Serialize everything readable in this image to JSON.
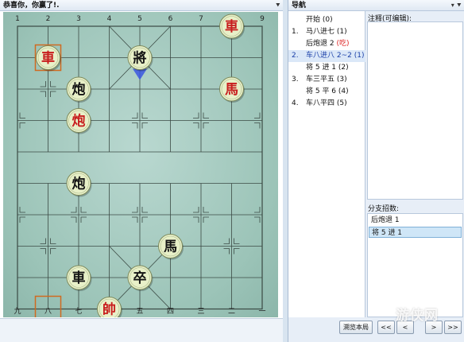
{
  "board_panel": {
    "title": "恭喜你，你赢了!."
  },
  "board": {
    "top_files": [
      "1",
      "2",
      "3",
      "4",
      "5",
      "6",
      "7",
      "8",
      "9"
    ],
    "bottom_files": [
      "九",
      "八",
      "七",
      "六",
      "五",
      "四",
      "三",
      "二",
      "一"
    ]
  },
  "pieces": [
    {
      "char": "車",
      "side": "red",
      "file": 7,
      "rank": 0
    },
    {
      "char": "車",
      "side": "red",
      "file": 1,
      "rank": 1
    },
    {
      "char": "將",
      "side": "black",
      "file": 4,
      "rank": 1
    },
    {
      "char": "炮",
      "side": "black",
      "file": 2,
      "rank": 2
    },
    {
      "char": "馬",
      "side": "red",
      "file": 7,
      "rank": 2
    },
    {
      "char": "炮",
      "side": "red",
      "file": 2,
      "rank": 3
    },
    {
      "char": "炮",
      "side": "black",
      "file": 2,
      "rank": 5
    },
    {
      "char": "馬",
      "side": "black",
      "file": 5,
      "rank": 7
    },
    {
      "char": "車",
      "side": "black",
      "file": 2,
      "rank": 8
    },
    {
      "char": "卒",
      "side": "black",
      "file": 4,
      "rank": 8
    },
    {
      "char": "帥",
      "side": "red",
      "file": 3,
      "rank": 9
    }
  ],
  "nav_panel": {
    "title": "导航",
    "notes_label": "注释(可编辑):",
    "branch_label": "分支招数:",
    "moves": [
      {
        "num": "",
        "text": "开始 (0)",
        "note": "",
        "selected": false
      },
      {
        "num": "1.",
        "text": "马八进七 (1)",
        "note": "",
        "selected": false
      },
      {
        "num": "",
        "text": "后炮退 2 ",
        "note": "(吃)",
        "selected": false
      },
      {
        "num": "2.",
        "text": "车八进八 2~2 (1)",
        "note": "",
        "selected": true
      },
      {
        "num": "",
        "text": "将 5 进 1 (2)",
        "note": "",
        "selected": false
      },
      {
        "num": "3.",
        "text": "车三平五 (3)",
        "note": "",
        "selected": false
      },
      {
        "num": "",
        "text": "将 5 平 6 (4)",
        "note": "",
        "selected": false
      },
      {
        "num": "4.",
        "text": "车八平四 (5)",
        "note": "",
        "selected": false
      }
    ],
    "branches": [
      {
        "text": "后炮退 1",
        "selected": false
      },
      {
        "text": "将 5 进 1",
        "selected": true
      }
    ],
    "buttons": {
      "browse": "溯览本局",
      "first": "<<",
      "prev": "<",
      "next": ">",
      "last": ">>"
    }
  },
  "watermark": "游侠网",
  "colors": {
    "board_line": "#3b4a44",
    "red_piece": "#c81e1e",
    "black_piece": "#141414",
    "piece_face": "#e8f0c8",
    "arrow": "#3a56e0",
    "highlight": "#d06a20"
  }
}
